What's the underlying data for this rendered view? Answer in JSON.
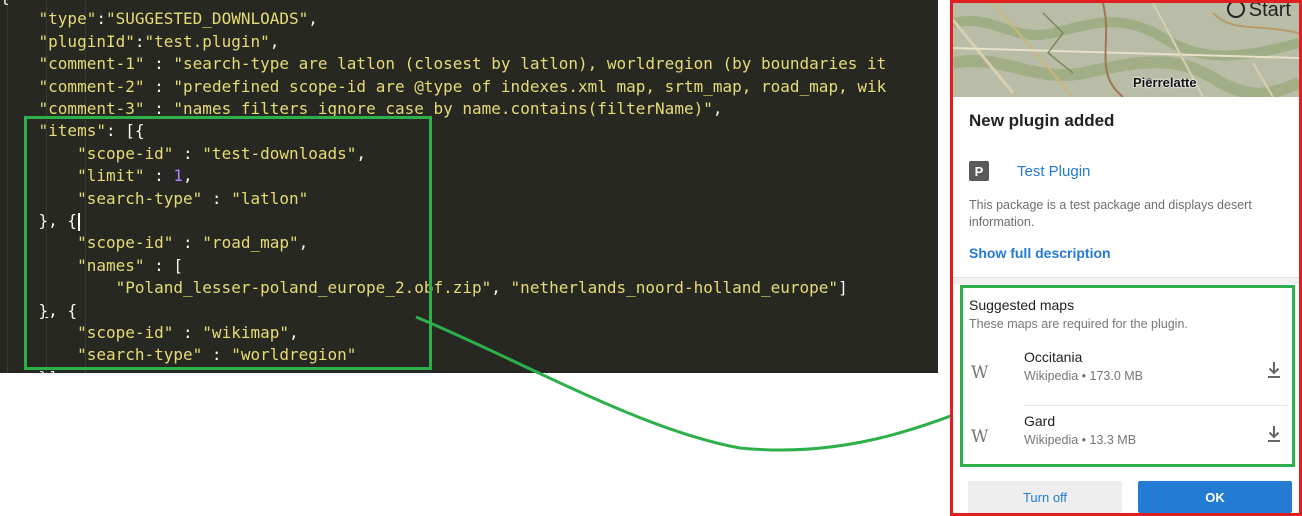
{
  "editor": {
    "lines": [
      {
        "parts": [
          {
            "t": "{",
            "c": "pun"
          }
        ]
      },
      {
        "parts": [
          {
            "t": "    ",
            "c": "pun"
          },
          {
            "t": "\"type\"",
            "c": "str"
          },
          {
            "t": ":",
            "c": "pun"
          },
          {
            "t": "\"SUGGESTED_DOWNLOADS\"",
            "c": "str"
          },
          {
            "t": ",",
            "c": "pun"
          }
        ]
      },
      {
        "parts": [
          {
            "t": "    ",
            "c": "pun"
          },
          {
            "t": "\"pluginId\"",
            "c": "str"
          },
          {
            "t": ":",
            "c": "pun"
          },
          {
            "t": "\"test.plugin\"",
            "c": "str"
          },
          {
            "t": ",",
            "c": "pun"
          }
        ]
      },
      {
        "parts": [
          {
            "t": "    ",
            "c": "pun"
          },
          {
            "t": "\"comment-1\"",
            "c": "str"
          },
          {
            "t": " : ",
            "c": "pun"
          },
          {
            "t": "\"search-type are latlon (closest by latlon), worldregion (by boundaries it",
            "c": "str"
          }
        ]
      },
      {
        "parts": [
          {
            "t": "    ",
            "c": "pun"
          },
          {
            "t": "\"comment-2\"",
            "c": "str"
          },
          {
            "t": " : ",
            "c": "pun"
          },
          {
            "t": "\"predefined scope-id are @type of indexes.xml map, srtm_map, road_map, wik",
            "c": "str"
          }
        ]
      },
      {
        "parts": [
          {
            "t": "    ",
            "c": "pun"
          },
          {
            "t": "\"comment-3\"",
            "c": "str"
          },
          {
            "t": " : ",
            "c": "pun"
          },
          {
            "t": "\"names filters ignore case by name.contains(filterName)\"",
            "c": "str"
          },
          {
            "t": ",",
            "c": "pun"
          }
        ]
      },
      {
        "parts": [
          {
            "t": "    ",
            "c": "pun"
          },
          {
            "t": "\"items\"",
            "c": "str"
          },
          {
            "t": ": [{",
            "c": "pun"
          }
        ]
      },
      {
        "parts": [
          {
            "t": "        ",
            "c": "pun"
          },
          {
            "t": "\"scope-id\"",
            "c": "str"
          },
          {
            "t": " : ",
            "c": "pun"
          },
          {
            "t": "\"test-downloads\"",
            "c": "str"
          },
          {
            "t": ",",
            "c": "pun"
          }
        ]
      },
      {
        "parts": [
          {
            "t": "        ",
            "c": "pun"
          },
          {
            "t": "\"limit\"",
            "c": "str"
          },
          {
            "t": " : ",
            "c": "pun"
          },
          {
            "t": "1",
            "c": "num"
          },
          {
            "t": ",",
            "c": "pun"
          }
        ]
      },
      {
        "parts": [
          {
            "t": "        ",
            "c": "pun"
          },
          {
            "t": "\"search-type\"",
            "c": "str"
          },
          {
            "t": " : ",
            "c": "pun"
          },
          {
            "t": "\"latlon\"",
            "c": "str"
          }
        ]
      },
      {
        "parts": [
          {
            "t": "    }, {",
            "c": "pun"
          }
        ],
        "cursor": true
      },
      {
        "parts": [
          {
            "t": "        ",
            "c": "pun"
          },
          {
            "t": "\"scope-id\"",
            "c": "str"
          },
          {
            "t": " : ",
            "c": "pun"
          },
          {
            "t": "\"road_map\"",
            "c": "str"
          },
          {
            "t": ",",
            "c": "pun"
          }
        ]
      },
      {
        "parts": [
          {
            "t": "        ",
            "c": "pun"
          },
          {
            "t": "\"names\"",
            "c": "str"
          },
          {
            "t": " : [",
            "c": "pun"
          }
        ]
      },
      {
        "parts": [
          {
            "t": "            ",
            "c": "pun"
          },
          {
            "t": "\"Poland_lesser-poland_europe_2.obf.zip\"",
            "c": "str"
          },
          {
            "t": ", ",
            "c": "pun"
          },
          {
            "t": "\"netherlands_noord-holland_europe\"",
            "c": "str"
          },
          {
            "t": "]",
            "c": "pun"
          }
        ]
      },
      {
        "parts": [
          {
            "t": "    ",
            "c": "pun"
          },
          {
            "t": "}",
            "c": "pun uline"
          },
          {
            "t": ", {",
            "c": "pun"
          }
        ]
      },
      {
        "parts": [
          {
            "t": "        ",
            "c": "pun"
          },
          {
            "t": "\"scope-id\"",
            "c": "str"
          },
          {
            "t": " : ",
            "c": "pun"
          },
          {
            "t": "\"wikimap\"",
            "c": "str"
          },
          {
            "t": ",",
            "c": "pun"
          }
        ]
      },
      {
        "parts": [
          {
            "t": "        ",
            "c": "pun"
          },
          {
            "t": "\"search-type\"",
            "c": "str"
          },
          {
            "t": " : ",
            "c": "pun"
          },
          {
            "t": "\"worldregion\"",
            "c": "str"
          }
        ]
      },
      {
        "parts": [
          {
            "t": "    }]",
            "c": "pun"
          }
        ]
      }
    ]
  },
  "phone": {
    "map": {
      "start_label": "Start",
      "city_label": "Pierrelatte"
    },
    "sheet": {
      "title": "New plugin added",
      "plugin_icon_letter": "P",
      "plugin_name": "Test Plugin",
      "description": "This package is a test package and displays desert information.",
      "show_full_label": "Show full description"
    },
    "suggested": {
      "title": "Suggested maps",
      "subtitle": "These maps are required for the plugin.",
      "items": [
        {
          "icon": "W",
          "name": "Occitania",
          "meta": "Wikipedia • 173.0 MB"
        },
        {
          "icon": "W",
          "name": "Gard",
          "meta": "Wikipedia • 13.3 MB"
        }
      ]
    },
    "buttons": {
      "turn_off_label": "Turn off",
      "ok_label": "OK"
    }
  },
  "colors": {
    "annotation_green": "#2db04b",
    "annotation_red": "#e02020",
    "accent_blue": "#237bd3",
    "editor_bg": "#272822"
  }
}
